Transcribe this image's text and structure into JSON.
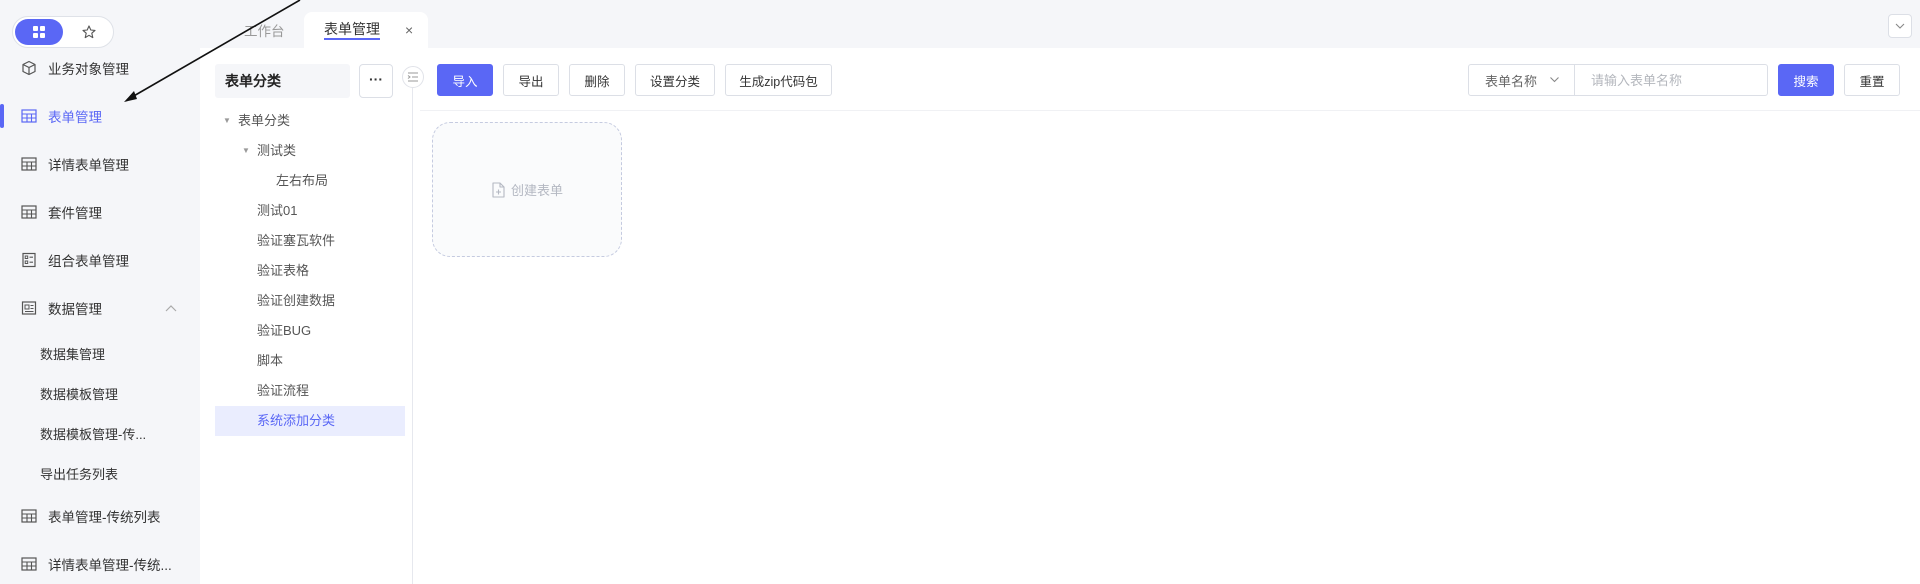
{
  "sidebar": {
    "switcher": {
      "grid_icon": "grid-icon",
      "star_icon": "star-icon"
    },
    "items": [
      {
        "label": "业务对象管理",
        "icon": "cube-icon"
      },
      {
        "label": "表单管理",
        "icon": "table-icon",
        "active": true
      },
      {
        "label": "详情表单管理",
        "icon": "table-icon"
      },
      {
        "label": "套件管理",
        "icon": "table-icon"
      },
      {
        "label": "组合表单管理",
        "icon": "list-form-icon"
      },
      {
        "label": "数据管理",
        "icon": "data-icon",
        "expanded": true
      },
      {
        "label": "表单管理-传统列表",
        "icon": "table-icon"
      },
      {
        "label": "详情表单管理-传统...",
        "icon": "table-icon"
      }
    ],
    "sub_items": [
      {
        "label": "数据集管理"
      },
      {
        "label": "数据模板管理"
      },
      {
        "label": "数据模板管理-传..."
      },
      {
        "label": "导出任务列表"
      }
    ]
  },
  "tabs": [
    {
      "label": "工作台"
    },
    {
      "label": "表单管理",
      "active": true,
      "close": "×"
    }
  ],
  "category_panel": {
    "title": "表单分类",
    "more_label": "···",
    "tree": [
      {
        "label": "表单分类",
        "level": 0,
        "expanded": true
      },
      {
        "label": "测试类",
        "level": 1,
        "expanded": true
      },
      {
        "label": "左右布局",
        "level": 2
      },
      {
        "label": "测试01",
        "level": 1
      },
      {
        "label": "验证塞瓦软件",
        "level": 1
      },
      {
        "label": "验证表格",
        "level": 1
      },
      {
        "label": "验证创建数据",
        "level": 1
      },
      {
        "label": "验证BUG",
        "level": 1
      },
      {
        "label": "脚本",
        "level": 1
      },
      {
        "label": "验证流程",
        "level": 1
      },
      {
        "label": "系统添加分类",
        "level": 1,
        "selected": true
      }
    ]
  },
  "toolbar": {
    "import_label": "导入",
    "export_label": "导出",
    "delete_label": "删除",
    "set_category_label": "设置分类",
    "zip_label": "生成zip代码包"
  },
  "search": {
    "field_label": "表单名称",
    "placeholder": "请输入表单名称",
    "search_label": "搜索",
    "reset_label": "重置"
  },
  "main": {
    "create_label": "创建表单"
  },
  "colors": {
    "accent": "#5a67f5",
    "sidebar_bg": "#f5f6f9",
    "selected_bg": "#eaedfe"
  }
}
